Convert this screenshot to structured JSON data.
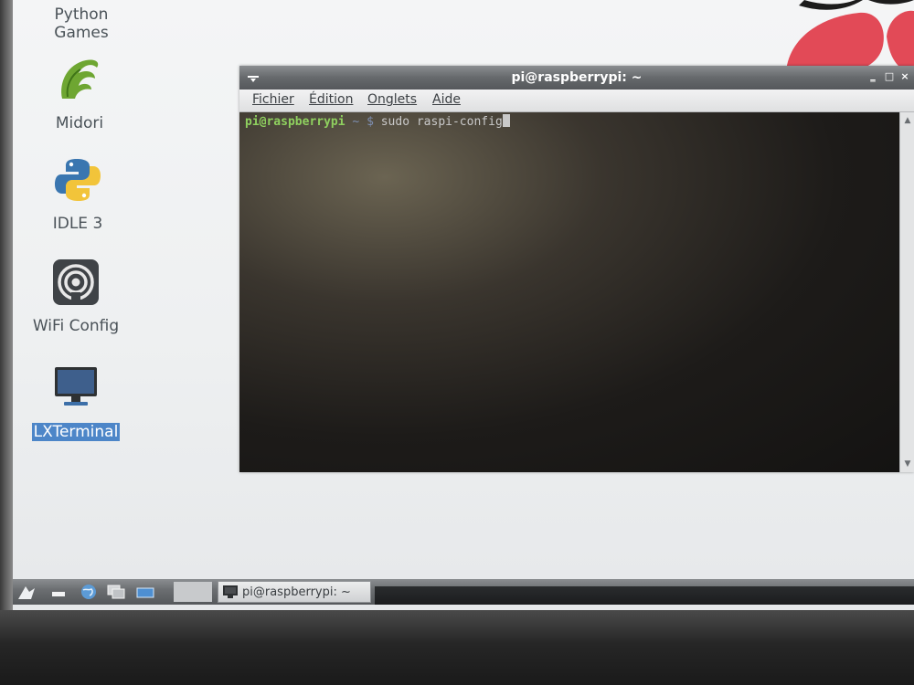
{
  "desktop": {
    "icons": [
      {
        "label_line1": "Python",
        "label_line2": "Games"
      },
      {
        "label": "Midori"
      },
      {
        "label": "IDLE 3"
      },
      {
        "label": "WiFi Config"
      },
      {
        "label": "LXTerminal"
      }
    ]
  },
  "window": {
    "title": "pi@raspberrypi: ~",
    "minimize_symbol": "‗",
    "maximize_symbol": "□",
    "close_symbol": "×",
    "menu": [
      "Fichier",
      "Édition",
      "Onglets",
      "Aide"
    ],
    "terminal": {
      "prompt_user": "pi@raspberrypi",
      "prompt_path": " ~ ",
      "prompt_symbol": "$",
      "command": " sudo raspi-config"
    }
  },
  "taskbar": {
    "task_label": "pi@raspberrypi: ~"
  },
  "colors": {
    "prompt_green": "#8fd05f",
    "selection_blue": "#4d86c8",
    "raspberry_red": "#e24a57"
  }
}
